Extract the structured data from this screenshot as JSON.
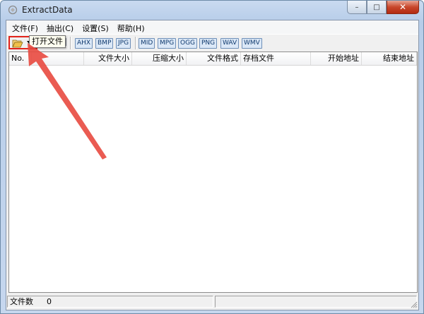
{
  "window": {
    "title": "ExtractData",
    "minimize_glyph": "–",
    "maximize_glyph": "□",
    "close_glyph": "✕"
  },
  "menu": [
    {
      "label": "文件(F)"
    },
    {
      "label": "抽出(C)"
    },
    {
      "label": "设置(S)"
    },
    {
      "label": "帮助(H)"
    }
  ],
  "toolbar": {
    "icons": [
      "open-folder-icon",
      "dropdown-arrow-icon",
      "save-icon",
      "save-all-icon"
    ],
    "filetypes": [
      "AHX",
      "BMP",
      "JPG",
      "MID",
      "MPG",
      "OGG",
      "PNG",
      "WAV",
      "WMV"
    ]
  },
  "tooltip": "打开文件",
  "columns": [
    "No.",
    "",
    "文件大小",
    "压缩大小",
    "文件格式",
    "存档文件",
    "开始地址",
    "结束地址"
  ],
  "status": {
    "label": "文件数",
    "count": "0"
  },
  "colors": {
    "highlight": "#e2231a",
    "arrow": "#e8493f"
  }
}
